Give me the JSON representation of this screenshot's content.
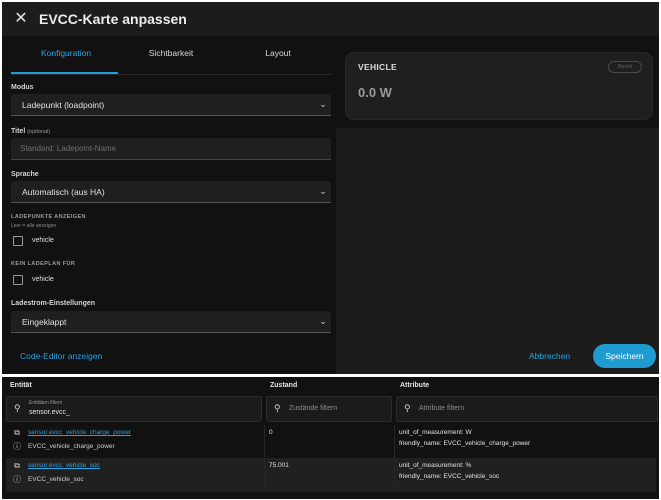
{
  "dialog": {
    "title": "EVCC-Karte anpassen",
    "close_icon": "close-icon",
    "tabs": [
      "Konfiguration",
      "Sichtbarkeit",
      "Layout"
    ],
    "active_tab": 0,
    "fields": {
      "mode_label": "Modus",
      "mode_value": "Ladepunkt (loadpoint)",
      "title_label": "Titel",
      "title_optional": "(optional)",
      "title_placeholder": "Standard: Ladepoint-Name",
      "language_label": "Sprache",
      "language_value": "Automatisch (aus HA)",
      "loadpoints_label": "LADEPUNKTE ANZEIGEN",
      "loadpoints_hint": "Leer = alle anzeigen",
      "loadpoints_option": "vehicle",
      "no_plan_label": "KEIN LADEPLAN FÜR",
      "no_plan_option": "vehicle",
      "current_label": "Ladestrom-Einstellungen",
      "current_value": "Eingeklappt"
    },
    "footer": {
      "code_editor": "Code-Editor anzeigen",
      "cancel": "Abbrechen",
      "save": "Speichern"
    },
    "preview": {
      "name": "VEHICLE",
      "value": "0.0 W",
      "badge": "Bereit"
    },
    "colors": {
      "accent": "#1e9bd1",
      "link": "#27a3e0",
      "background": "#1c1c1c",
      "pane": "#111111"
    }
  },
  "table": {
    "headers": [
      "Entität",
      "Zustand",
      "Attribute"
    ],
    "entity_filter_label": "Entitäten filtern",
    "entity_filter_value": "sensor.evcc_",
    "state_filter_placeholder": "Zustände filtern",
    "attr_filter_placeholder": "Attribute filtern",
    "search_icon": "search-icon",
    "rows": [
      {
        "entity_id": "sensor.evcc_vehicle_charge_power",
        "friendly": "EVCC_vehicle_charge_power",
        "state": "0",
        "attr1": "unit_of_measurement: W",
        "attr2": "friendly_name: EVCC_vehicle_charge_power"
      },
      {
        "entity_id": "sensor.evcc_vehicle_soc",
        "friendly": "EVCC_vehicle_soc",
        "state": "75.001",
        "attr1": "unit_of_measurement: %",
        "attr2": "friendly_name: EVCC_vehicle_soc"
      }
    ]
  }
}
